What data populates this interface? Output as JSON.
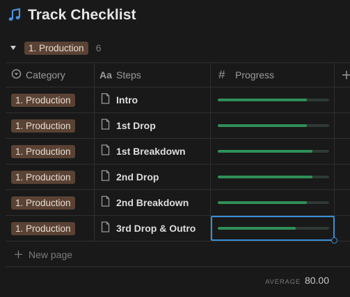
{
  "page": {
    "title": "Track Checklist",
    "title_icon": "music-note-icon",
    "accent_color": "#3a8ed8"
  },
  "group": {
    "label": "1. Production",
    "count": "6",
    "tag_color": "#5a4234"
  },
  "columns": [
    {
      "label": "Category",
      "icon": "select-circle-icon"
    },
    {
      "label": "Steps",
      "icon": "text-aa-icon"
    },
    {
      "label": "Progress",
      "icon": "hash-icon"
    }
  ],
  "rows": [
    {
      "category": "1. Production",
      "step": "Intro",
      "progress": 0.8
    },
    {
      "category": "1. Production",
      "step": "1st Drop",
      "progress": 0.8
    },
    {
      "category": "1. Production",
      "step": "1st Breakdown",
      "progress": 0.85
    },
    {
      "category": "1. Production",
      "step": "2nd Drop",
      "progress": 0.85
    },
    {
      "category": "1. Production",
      "step": "2nd Breakdown",
      "progress": 0.8
    },
    {
      "category": "1. Production",
      "step": "3rd Drop & Outro",
      "progress": 0.7
    }
  ],
  "progress_color": "#2f8f57",
  "new_page_label": "New page",
  "footer": {
    "label": "AVERAGE",
    "value": "80.00"
  }
}
